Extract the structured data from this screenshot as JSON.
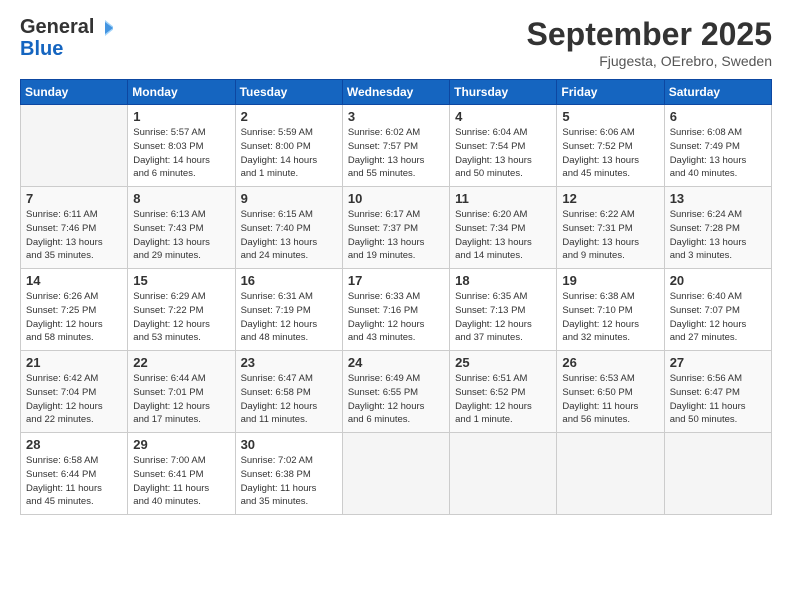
{
  "header": {
    "logo_general": "General",
    "logo_blue": "Blue",
    "month": "September 2025",
    "location": "Fjugesta, OErebro, Sweden"
  },
  "days_of_week": [
    "Sunday",
    "Monday",
    "Tuesday",
    "Wednesday",
    "Thursday",
    "Friday",
    "Saturday"
  ],
  "weeks": [
    [
      {
        "day": "",
        "info": ""
      },
      {
        "day": "1",
        "info": "Sunrise: 5:57 AM\nSunset: 8:03 PM\nDaylight: 14 hours\nand 6 minutes."
      },
      {
        "day": "2",
        "info": "Sunrise: 5:59 AM\nSunset: 8:00 PM\nDaylight: 14 hours\nand 1 minute."
      },
      {
        "day": "3",
        "info": "Sunrise: 6:02 AM\nSunset: 7:57 PM\nDaylight: 13 hours\nand 55 minutes."
      },
      {
        "day": "4",
        "info": "Sunrise: 6:04 AM\nSunset: 7:54 PM\nDaylight: 13 hours\nand 50 minutes."
      },
      {
        "day": "5",
        "info": "Sunrise: 6:06 AM\nSunset: 7:52 PM\nDaylight: 13 hours\nand 45 minutes."
      },
      {
        "day": "6",
        "info": "Sunrise: 6:08 AM\nSunset: 7:49 PM\nDaylight: 13 hours\nand 40 minutes."
      }
    ],
    [
      {
        "day": "7",
        "info": "Sunrise: 6:11 AM\nSunset: 7:46 PM\nDaylight: 13 hours\nand 35 minutes."
      },
      {
        "day": "8",
        "info": "Sunrise: 6:13 AM\nSunset: 7:43 PM\nDaylight: 13 hours\nand 29 minutes."
      },
      {
        "day": "9",
        "info": "Sunrise: 6:15 AM\nSunset: 7:40 PM\nDaylight: 13 hours\nand 24 minutes."
      },
      {
        "day": "10",
        "info": "Sunrise: 6:17 AM\nSunset: 7:37 PM\nDaylight: 13 hours\nand 19 minutes."
      },
      {
        "day": "11",
        "info": "Sunrise: 6:20 AM\nSunset: 7:34 PM\nDaylight: 13 hours\nand 14 minutes."
      },
      {
        "day": "12",
        "info": "Sunrise: 6:22 AM\nSunset: 7:31 PM\nDaylight: 13 hours\nand 9 minutes."
      },
      {
        "day": "13",
        "info": "Sunrise: 6:24 AM\nSunset: 7:28 PM\nDaylight: 13 hours\nand 3 minutes."
      }
    ],
    [
      {
        "day": "14",
        "info": "Sunrise: 6:26 AM\nSunset: 7:25 PM\nDaylight: 12 hours\nand 58 minutes."
      },
      {
        "day": "15",
        "info": "Sunrise: 6:29 AM\nSunset: 7:22 PM\nDaylight: 12 hours\nand 53 minutes."
      },
      {
        "day": "16",
        "info": "Sunrise: 6:31 AM\nSunset: 7:19 PM\nDaylight: 12 hours\nand 48 minutes."
      },
      {
        "day": "17",
        "info": "Sunrise: 6:33 AM\nSunset: 7:16 PM\nDaylight: 12 hours\nand 43 minutes."
      },
      {
        "day": "18",
        "info": "Sunrise: 6:35 AM\nSunset: 7:13 PM\nDaylight: 12 hours\nand 37 minutes."
      },
      {
        "day": "19",
        "info": "Sunrise: 6:38 AM\nSunset: 7:10 PM\nDaylight: 12 hours\nand 32 minutes."
      },
      {
        "day": "20",
        "info": "Sunrise: 6:40 AM\nSunset: 7:07 PM\nDaylight: 12 hours\nand 27 minutes."
      }
    ],
    [
      {
        "day": "21",
        "info": "Sunrise: 6:42 AM\nSunset: 7:04 PM\nDaylight: 12 hours\nand 22 minutes."
      },
      {
        "day": "22",
        "info": "Sunrise: 6:44 AM\nSunset: 7:01 PM\nDaylight: 12 hours\nand 17 minutes."
      },
      {
        "day": "23",
        "info": "Sunrise: 6:47 AM\nSunset: 6:58 PM\nDaylight: 12 hours\nand 11 minutes."
      },
      {
        "day": "24",
        "info": "Sunrise: 6:49 AM\nSunset: 6:55 PM\nDaylight: 12 hours\nand 6 minutes."
      },
      {
        "day": "25",
        "info": "Sunrise: 6:51 AM\nSunset: 6:52 PM\nDaylight: 12 hours\nand 1 minute."
      },
      {
        "day": "26",
        "info": "Sunrise: 6:53 AM\nSunset: 6:50 PM\nDaylight: 11 hours\nand 56 minutes."
      },
      {
        "day": "27",
        "info": "Sunrise: 6:56 AM\nSunset: 6:47 PM\nDaylight: 11 hours\nand 50 minutes."
      }
    ],
    [
      {
        "day": "28",
        "info": "Sunrise: 6:58 AM\nSunset: 6:44 PM\nDaylight: 11 hours\nand 45 minutes."
      },
      {
        "day": "29",
        "info": "Sunrise: 7:00 AM\nSunset: 6:41 PM\nDaylight: 11 hours\nand 40 minutes."
      },
      {
        "day": "30",
        "info": "Sunrise: 7:02 AM\nSunset: 6:38 PM\nDaylight: 11 hours\nand 35 minutes."
      },
      {
        "day": "",
        "info": ""
      },
      {
        "day": "",
        "info": ""
      },
      {
        "day": "",
        "info": ""
      },
      {
        "day": "",
        "info": ""
      }
    ]
  ]
}
